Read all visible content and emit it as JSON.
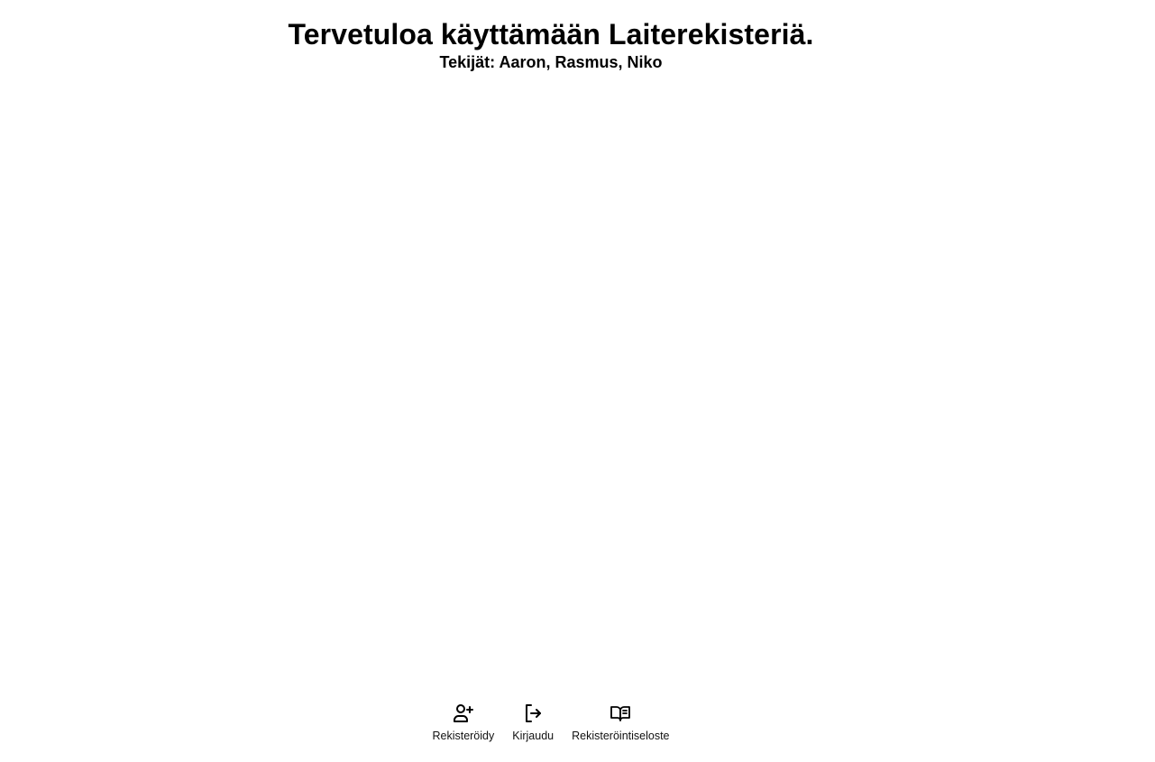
{
  "header": {
    "title": "Tervetuloa käyttämään Laiterekisteriä.",
    "subtitle": "Tekijät: Aaron, Rasmus, Niko"
  },
  "bottom_nav": {
    "items": [
      {
        "label": "Rekisteröidy",
        "icon": "person-add-icon"
      },
      {
        "label": "Kirjaudu",
        "icon": "login-icon"
      },
      {
        "label": "Rekisteröintiseloste",
        "icon": "open-book-icon"
      }
    ]
  }
}
